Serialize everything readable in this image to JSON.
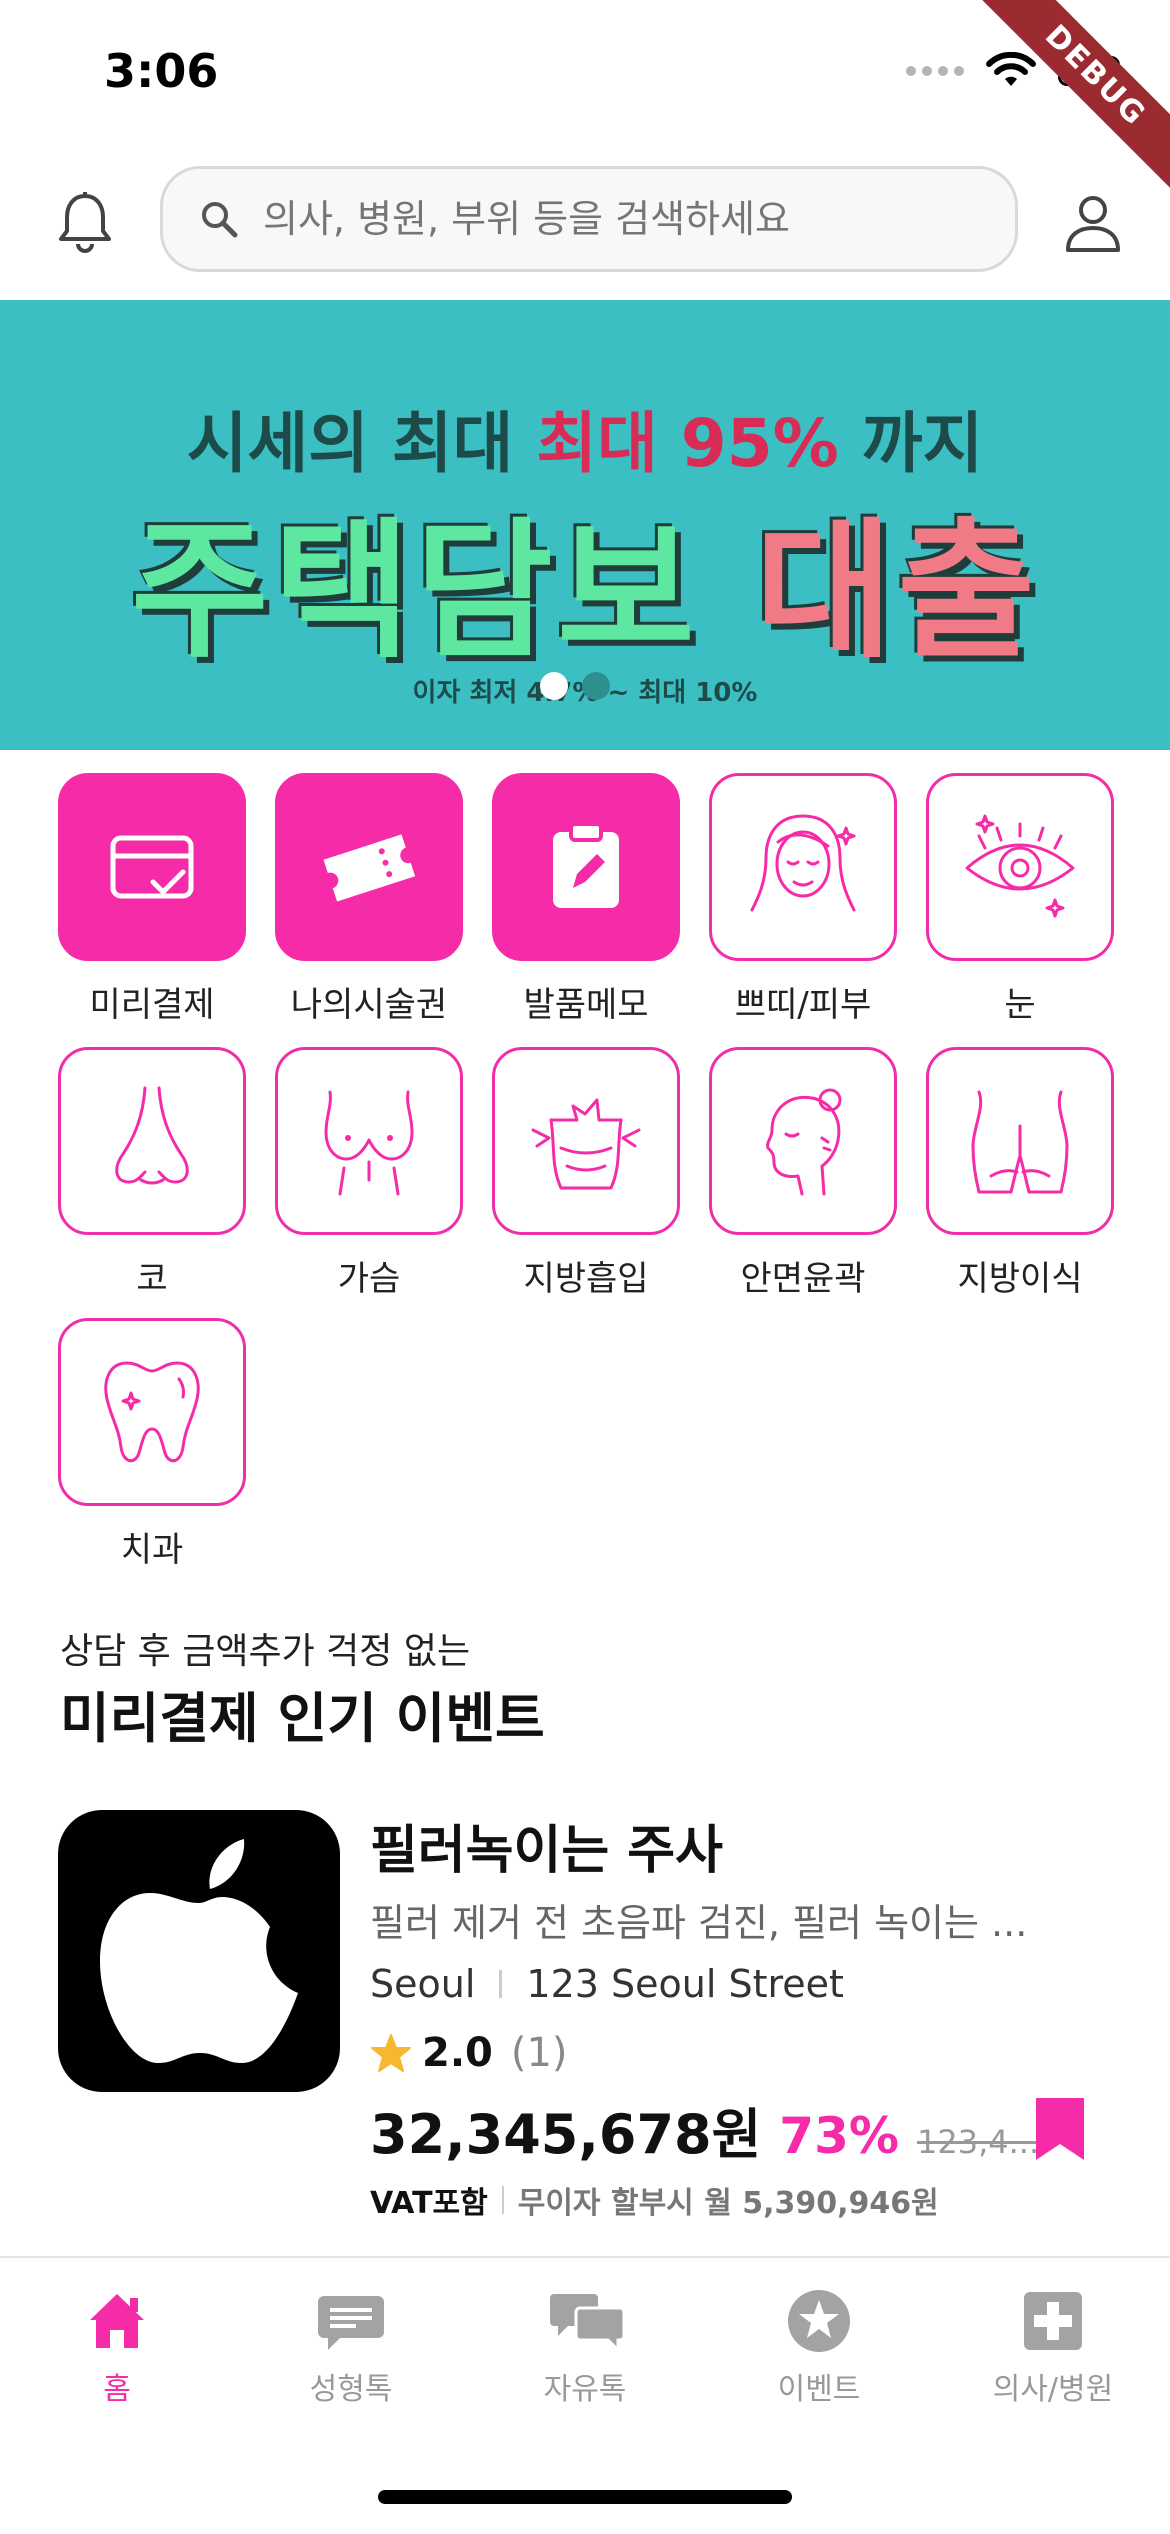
{
  "status_bar": {
    "time": "3:06",
    "debug_label": "DEBUG"
  },
  "header": {
    "search_placeholder": "의사, 병원, 부위 등을 검색하세요"
  },
  "banner": {
    "line1_a": "시세의 최대 ",
    "line1_b": "최대 95%",
    "line1_c": " 까지",
    "line2_a": "주택담보 ",
    "line2_b": "대출",
    "line3": "이자 최저 4.7% ~ 최대 10%",
    "page_count": 2,
    "active_page": 0
  },
  "categories": [
    {
      "label": "미리결제",
      "icon": "card-check-icon",
      "filled": true
    },
    {
      "label": "나의시술권",
      "icon": "ticket-icon",
      "filled": true
    },
    {
      "label": "발품메모",
      "icon": "memo-edit-icon",
      "filled": true
    },
    {
      "label": "쁘띠/피부",
      "icon": "face-skin-icon",
      "filled": false
    },
    {
      "label": "눈",
      "icon": "eye-icon",
      "filled": false
    },
    {
      "label": "코",
      "icon": "nose-icon",
      "filled": false
    },
    {
      "label": "가슴",
      "icon": "chest-icon",
      "filled": false
    },
    {
      "label": "지방흡입",
      "icon": "liposuction-icon",
      "filled": false
    },
    {
      "label": "안면윤곽",
      "icon": "face-contour-icon",
      "filled": false
    },
    {
      "label": "지방이식",
      "icon": "hip-icon",
      "filled": false
    },
    {
      "label": "치과",
      "icon": "tooth-icon",
      "filled": false
    }
  ],
  "section": {
    "subtitle": "상담 후 금액추가 걱정 없는",
    "title": "미리결제 인기 이벤트"
  },
  "event": {
    "title": "필러녹이는 주사",
    "description": "필러 제거 전 초음파 검진, 필러 녹이는 ...",
    "city": "Seoul",
    "address": "123 Seoul Street",
    "rating": "2.0",
    "review_count": "(1)",
    "price": "32,345,678원",
    "discount": "73%",
    "original_price": "123,4...",
    "vat": "VAT포함",
    "installment": "무이자 할부시 월 5,390,946원",
    "thumbnail_icon": "apple-logo-icon"
  },
  "bottom_nav": [
    {
      "label": "홈",
      "icon": "home-icon",
      "active": true
    },
    {
      "label": "성형톡",
      "icon": "chat-bubble-icon",
      "active": false
    },
    {
      "label": "자유톡",
      "icon": "chat-bubbles-icon",
      "active": false
    },
    {
      "label": "이벤트",
      "icon": "star-badge-icon",
      "active": false
    },
    {
      "label": "의사/병원",
      "icon": "medical-cross-icon",
      "active": false
    }
  ],
  "colors": {
    "accent": "#f52ba8",
    "banner_bg": "#3bbfc3"
  }
}
